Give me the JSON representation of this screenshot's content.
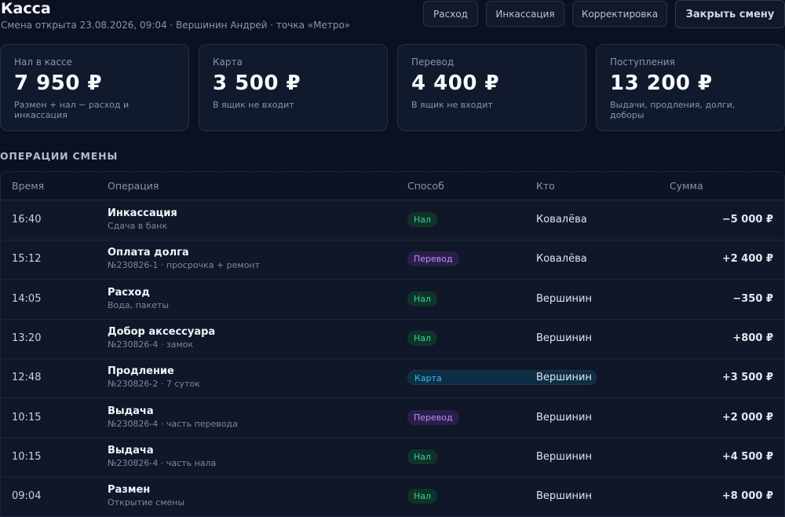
{
  "header": {
    "title": "Касса",
    "subtitle": "Смена открыта 23.08.2026, 09:04 · Вершинин Андрей · точка «Метро»",
    "buttons": {
      "expense": "Расход",
      "collection": "Инкассация",
      "adjustment": "Корректировка",
      "close_shift": "Закрыть смену"
    }
  },
  "cards": [
    {
      "label": "Нал в кассе",
      "value": "7 950 ₽",
      "note": "Размен + нал − расход и инкассация"
    },
    {
      "label": "Карта",
      "value": "3 500 ₽",
      "note": "В ящик не входит"
    },
    {
      "label": "Перевод",
      "value": "4 400 ₽",
      "note": "В ящик не входит"
    },
    {
      "label": "Поступления",
      "value": "13 200 ₽",
      "note": "Выдачи, продления, долги, доборы"
    }
  ],
  "operations": {
    "section_title": "ОПЕРАЦИИ СМЕНЫ",
    "columns": {
      "time": "Время",
      "operation": "Операция",
      "method": "Способ",
      "who": "Кто",
      "amount": "Сумма"
    },
    "rows": [
      {
        "time": "16:40",
        "title": "Инкассация",
        "sub": "Сдача в банк",
        "method": "Нал",
        "method_type": "cash",
        "who": "Ковалёва",
        "amount": "−5 000 ₽"
      },
      {
        "time": "15:12",
        "title": "Оплата долга",
        "sub": "№230826-1 · просрочка + ремонт",
        "method": "Перевод",
        "method_type": "transfer",
        "who": "Ковалёва",
        "amount": "+2 400 ₽"
      },
      {
        "time": "14:05",
        "title": "Расход",
        "sub": "Вода, пакеты",
        "method": "Нал",
        "method_type": "cash",
        "who": "Вершинин",
        "amount": "−350 ₽"
      },
      {
        "time": "13:20",
        "title": "Добор аксессуара",
        "sub": "№230826-4 · замок",
        "method": "Нал",
        "method_type": "cash",
        "who": "Вершинин",
        "amount": "+800 ₽"
      },
      {
        "time": "12:48",
        "title": "Продление",
        "sub": "№230826-2 · 7 суток",
        "method": "Карта",
        "method_type": "card",
        "who": "Вершинин",
        "amount": "+3 500 ₽"
      },
      {
        "time": "10:15",
        "title": "Выдача",
        "sub": "№230826-4 · часть перевода",
        "method": "Перевод",
        "method_type": "transfer",
        "who": "Вершинин",
        "amount": "+2 000 ₽"
      },
      {
        "time": "10:15",
        "title": "Выдача",
        "sub": "№230826-4 · часть нала",
        "method": "Нал",
        "method_type": "cash",
        "who": "Вершинин",
        "amount": "+4 500 ₽"
      },
      {
        "time": "09:04",
        "title": "Размен",
        "sub": "Открытие смены",
        "method": "Нал",
        "method_type": "cash",
        "who": "Вершинин",
        "amount": "+8 000 ₽"
      }
    ]
  },
  "colors": {
    "background": "#0b1120",
    "cash_badge": "#34d399",
    "transfer_badge": "#b692f6",
    "card_badge": "#38bdf8"
  }
}
